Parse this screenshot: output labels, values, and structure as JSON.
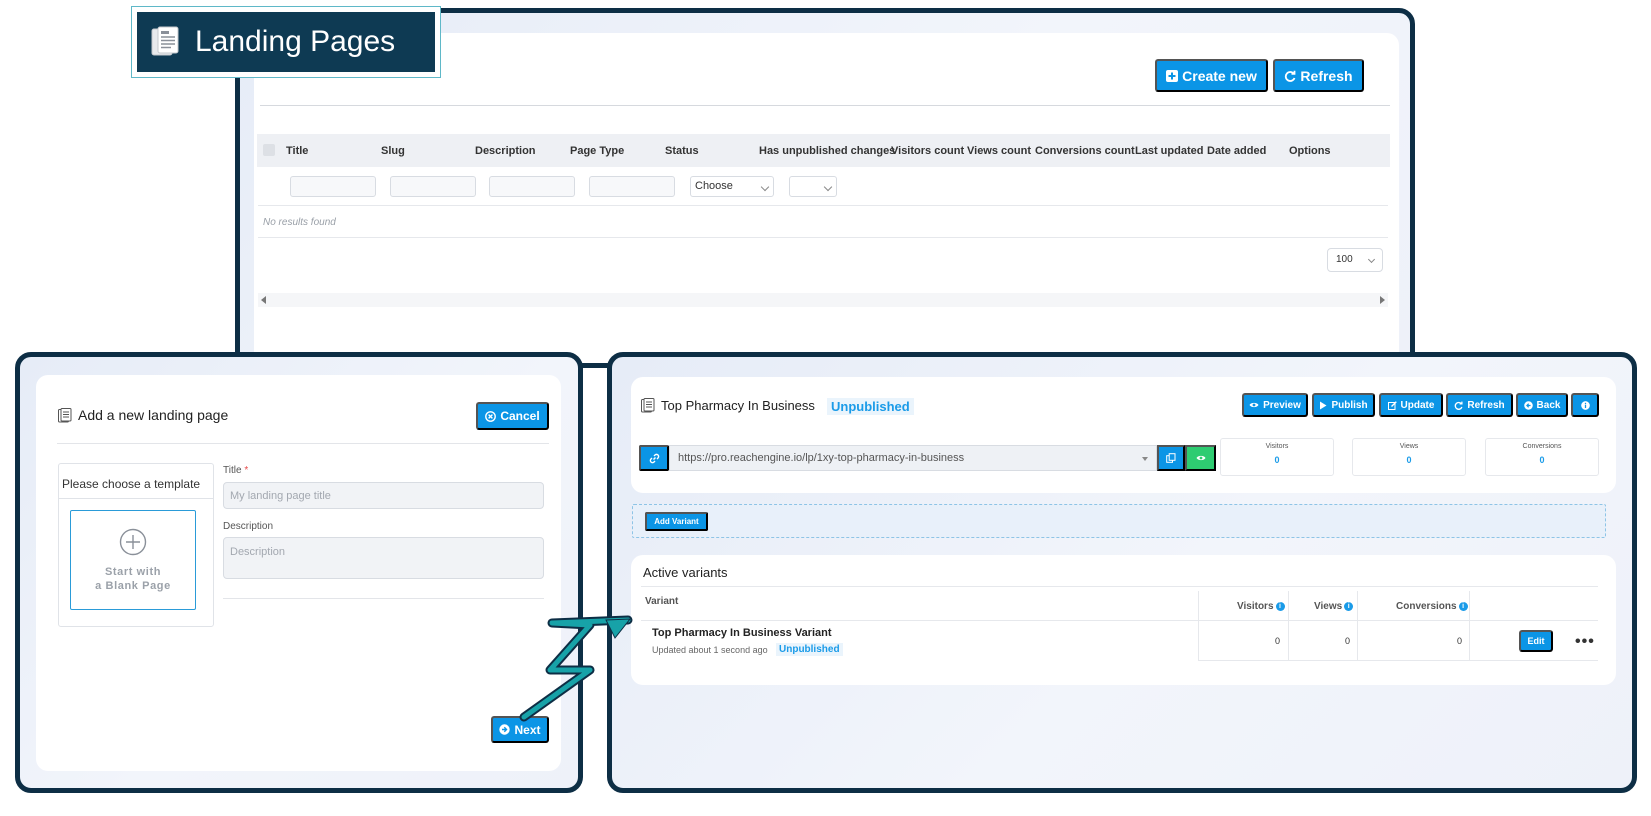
{
  "header": {
    "title": "Landing Pages"
  },
  "list_view": {
    "create_label": "Create new",
    "refresh_label": "Refresh",
    "columns": [
      "Title",
      "Slug",
      "Description",
      "Page Type",
      "Status",
      "Has unpublished changes",
      "Visitors count",
      "Views count",
      "Conversions count",
      "Last updated",
      "Date added",
      "Options"
    ],
    "status_filter_value": "Choose",
    "empty_message": "No results found",
    "per_page": "100"
  },
  "new_page_form": {
    "title": "Add a new landing page",
    "cancel_label": "Cancel",
    "template_prompt": "Please choose a template",
    "blank_line1": "Start with",
    "blank_line2": "a Blank Page",
    "title_label": "Title",
    "required_mark": "*",
    "title_placeholder": "My landing page title",
    "description_label": "Description",
    "description_placeholder": "Description",
    "next_label": "Next"
  },
  "editor": {
    "page_title": "Top Pharmacy In Business",
    "status": "Unpublished",
    "buttons": {
      "preview": "Preview",
      "publish": "Publish",
      "update": "Update",
      "refresh": "Refresh",
      "back": "Back"
    },
    "url": "https://pro.reachengine.io/lp/1xy-top-pharmacy-in-business",
    "stats": [
      {
        "label": "Visitors",
        "value": "0"
      },
      {
        "label": "Views",
        "value": "0"
      },
      {
        "label": "Conversions",
        "value": "0"
      }
    ],
    "add_variant_label": "Add Variant",
    "variants_title": "Active variants",
    "variant_columns": {
      "variant": "Variant",
      "visitors": "Visitors",
      "views": "Views",
      "conversions": "Conversions"
    },
    "variant": {
      "name": "Top Pharmacy In Business Variant",
      "updated": "Updated about 1 second ago",
      "status": "Unpublished",
      "visitors": "0",
      "views": "0",
      "conversions": "0",
      "edit_label": "Edit"
    }
  },
  "colors": {
    "navy": "#0e3a53",
    "frame": "#0d2e45",
    "primary": "#0b95e6",
    "success": "#2ecc71",
    "connector": "#17a2a8"
  }
}
